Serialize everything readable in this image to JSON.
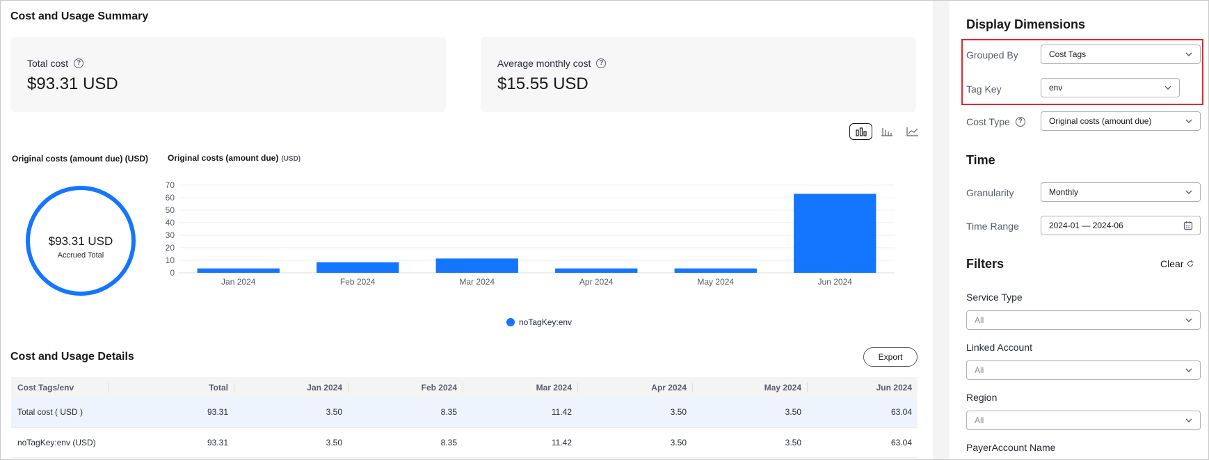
{
  "summary": {
    "title": "Cost and Usage Summary",
    "total_cost_label": "Total cost",
    "total_cost_value": "$93.31 USD",
    "avg_cost_label": "Average monthly cost",
    "avg_cost_value": "$15.55 USD"
  },
  "donut": {
    "title": "Original costs (amount due) (USD)",
    "value": "$93.31 USD",
    "label": "Accrued Total"
  },
  "chart_title": "Original costs (amount due)",
  "chart_unit": "(USD)",
  "chart_data": {
    "type": "bar",
    "title": "Original costs (amount due) (USD)",
    "categories": [
      "Jan 2024",
      "Feb 2024",
      "Mar 2024",
      "Apr 2024",
      "May 2024",
      "Jun 2024"
    ],
    "series": [
      {
        "name": "noTagKey:env",
        "values": [
          3.5,
          8.35,
          11.42,
          3.5,
          3.5,
          63.04
        ],
        "color": "#1476ff"
      }
    ],
    "ylim": [
      0,
      70
    ],
    "yticks": [
      0,
      10,
      20,
      30,
      40,
      50,
      60,
      70
    ],
    "grid": true,
    "legend": "bottom-center"
  },
  "details": {
    "title": "Cost and Usage Details",
    "export_label": "Export",
    "columns": [
      "Cost Tags/env",
      "Total",
      "Jan 2024",
      "Feb 2024",
      "Mar 2024",
      "Apr 2024",
      "May 2024",
      "Jun 2024"
    ],
    "rows": [
      [
        "Total cost ( USD )",
        "93.31",
        "3.50",
        "8.35",
        "11.42",
        "3.50",
        "3.50",
        "63.04"
      ],
      [
        "noTagKey:env (USD)",
        "93.31",
        "3.50",
        "8.35",
        "11.42",
        "3.50",
        "3.50",
        "63.04"
      ]
    ]
  },
  "panel": {
    "display_dimensions_title": "Display Dimensions",
    "grouped_by_label": "Grouped By",
    "grouped_by_value": "Cost Tags",
    "tag_key_label": "Tag Key",
    "tag_key_value": "env",
    "cost_type_label": "Cost Type",
    "cost_type_value": "Original costs (amount due)",
    "time_title": "Time",
    "granularity_label": "Granularity",
    "granularity_value": "Monthly",
    "time_range_label": "Time Range",
    "time_range_value": "2024-01 — 2024-06",
    "filters_title": "Filters",
    "clear_label": "Clear",
    "service_type_label": "Service Type",
    "service_type_value": "All",
    "linked_account_label": "Linked Account",
    "linked_account_value": "All",
    "region_label": "Region",
    "region_value": "All",
    "payer_account_label": "PayerAccount Name"
  },
  "colors": {
    "accent": "#1476ff",
    "highlight": "#e3262d"
  }
}
